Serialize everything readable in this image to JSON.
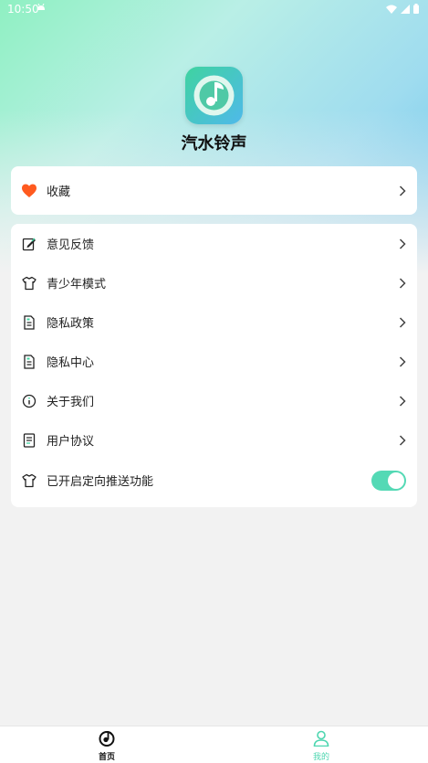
{
  "status_bar": {
    "time": "10:50",
    "icons": [
      "android-icon",
      "wifi-icon",
      "signal-icon",
      "battery-icon"
    ]
  },
  "header": {
    "app_name": "汽水铃声",
    "logo_icon": "music-note-icon"
  },
  "favorites": {
    "label": "收藏",
    "icon": "heart-icon"
  },
  "menu": {
    "items": [
      {
        "label": "意见反馈",
        "icon": "edit-icon"
      },
      {
        "label": "青少年模式",
        "icon": "shirt-icon"
      },
      {
        "label": "隐私政策",
        "icon": "document-icon"
      },
      {
        "label": "隐私中心",
        "icon": "document-icon"
      },
      {
        "label": "关于我们",
        "icon": "info-icon"
      },
      {
        "label": "用户协议",
        "icon": "agreement-icon"
      },
      {
        "label": "已开启定向推送功能",
        "icon": "shirt-icon",
        "toggle_on": true
      }
    ]
  },
  "bottom_nav": {
    "items": [
      {
        "label": "首页",
        "icon": "music-disc-icon",
        "active": false
      },
      {
        "label": "我的",
        "icon": "person-icon",
        "active": true
      }
    ]
  },
  "colors": {
    "accent": "#4dd6b0",
    "heart": "#ff5a1f"
  }
}
